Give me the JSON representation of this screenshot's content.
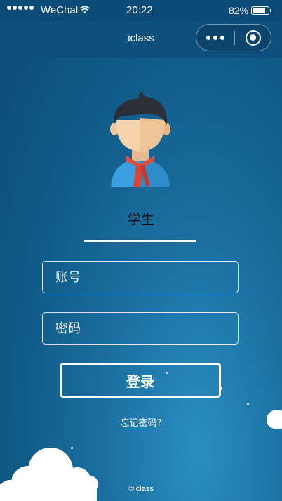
{
  "status_bar": {
    "carrier": "WeChat",
    "time": "20:22",
    "battery": "82%",
    "battery_level": 0.82
  },
  "nav": {
    "title": "iclass"
  },
  "login": {
    "role_label": "学生",
    "account_placeholder": "账号",
    "password_placeholder": "密码",
    "login_button": "登录",
    "forgot_password": "忘记密码?"
  },
  "footer": {
    "copyright": "©iclass"
  },
  "icons": {
    "signal": "signal-dots-icon",
    "wifi": "wifi-icon",
    "battery": "battery-icon",
    "more": "more-dots-icon",
    "close": "target-close-icon",
    "avatar": "student-avatar-icon"
  },
  "colors": {
    "background_top": "#0b4b76",
    "background_bottom": "#2a8fc0",
    "nav_bar": "#0d4f7d",
    "role_text": "#111111"
  }
}
